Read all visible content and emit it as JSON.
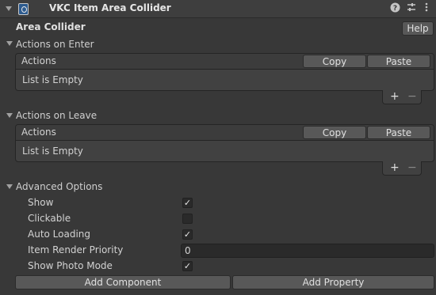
{
  "component": {
    "title": "VKC Item Area Collider",
    "help_icon": "question-icon",
    "preset_icon": "sliders-icon",
    "menu_icon": "kebab-menu-icon"
  },
  "section": {
    "title": "Area Collider",
    "help_label": "Help"
  },
  "on_enter": {
    "label": "Actions on Enter",
    "list_header": "Actions",
    "copy_label": "Copy",
    "paste_label": "Paste",
    "empty_text": "List is Empty",
    "add_symbol": "+",
    "remove_symbol": "−"
  },
  "on_leave": {
    "label": "Actions on Leave",
    "list_header": "Actions",
    "copy_label": "Copy",
    "paste_label": "Paste",
    "empty_text": "List is Empty",
    "add_symbol": "+",
    "remove_symbol": "−"
  },
  "advanced": {
    "label": "Advanced Options",
    "show_label": "Show",
    "show_checked": "✓",
    "clickable_label": "Clickable",
    "clickable_checked": "",
    "auto_loading_label": "Auto Loading",
    "auto_loading_checked": "✓",
    "render_priority_label": "Item Render Priority",
    "render_priority_value": "0",
    "photo_mode_label": "Show Photo Mode",
    "photo_mode_checked": "✓"
  },
  "footer": {
    "add_component_label": "Add Component",
    "add_property_label": "Add Property"
  }
}
